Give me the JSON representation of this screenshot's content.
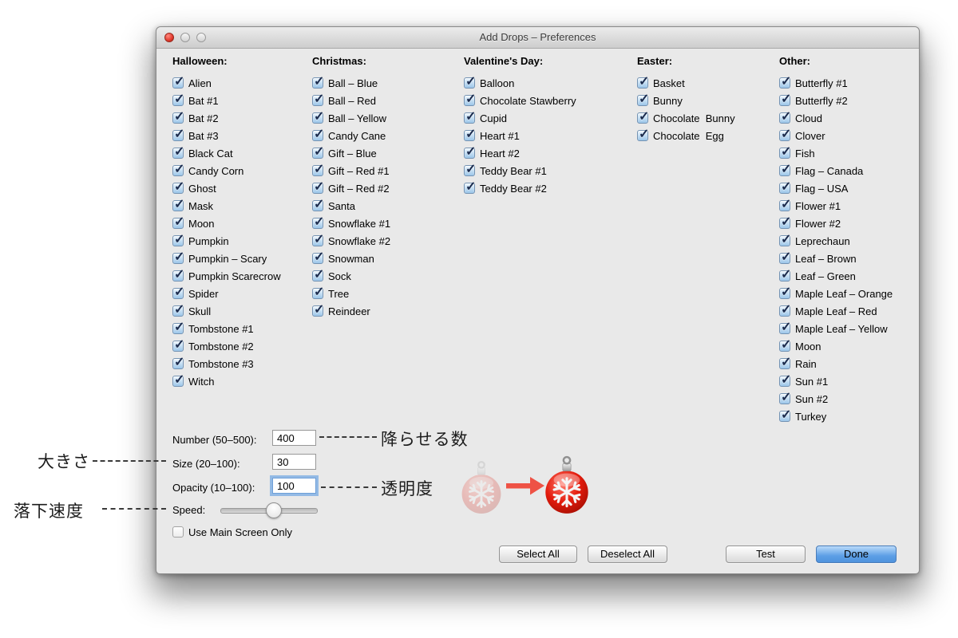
{
  "window": {
    "title": "Add Drops – Preferences"
  },
  "columns": [
    {
      "header": "Halloween:",
      "checked": true,
      "items": [
        "Alien",
        "Bat #1",
        "Bat #2",
        "Bat #3",
        "Black Cat",
        "Candy Corn",
        "Ghost",
        "Mask",
        "Moon",
        "Pumpkin",
        "Pumpkin – Scary",
        "Pumpkin Scarecrow",
        "Spider",
        "Skull",
        "Tombstone #1",
        "Tombstone #2",
        "Tombstone #3",
        "Witch"
      ]
    },
    {
      "header": "Christmas:",
      "checked": true,
      "items": [
        "Ball – Blue",
        "Ball – Red",
        "Ball – Yellow",
        "Candy Cane",
        "Gift – Blue",
        "Gift – Red #1",
        "Gift – Red #2",
        "Santa",
        "Snowflake #1",
        "Snowflake #2",
        "Snowman",
        "Sock",
        "Tree",
        "Reindeer"
      ]
    },
    {
      "header": "Valentine's Day:",
      "checked": true,
      "items": [
        "Balloon",
        "Chocolate Stawberry",
        "Cupid",
        "Heart #1",
        "Heart #2",
        "Teddy Bear #1",
        "Teddy Bear #2"
      ]
    },
    {
      "header": "Easter:",
      "checked": true,
      "items": [
        "Basket",
        "Bunny",
        "Chocolate  Bunny",
        "Chocolate  Egg"
      ]
    },
    {
      "header": "Other:",
      "checked": true,
      "items": [
        "Butterfly #1",
        "Butterfly #2",
        "Cloud",
        "Clover",
        "Fish",
        "Flag – Canada",
        "Flag – USA",
        "Flower #1",
        "Flower #2",
        "Leprechaun",
        "Leaf – Brown",
        "Leaf – Green",
        "Maple Leaf – Orange",
        "Maple Leaf – Red",
        "Maple Leaf – Yellow",
        "Moon",
        "Rain",
        "Sun #1",
        "Sun #2",
        "Turkey"
      ]
    }
  ],
  "form": {
    "number": {
      "label": "Number (50–500):",
      "value": "400"
    },
    "size": {
      "label": "Size (20–100):",
      "value": "30"
    },
    "opacity": {
      "label": "Opacity (10–100):",
      "value": "100",
      "focused": true
    },
    "speed": {
      "label": "Speed:",
      "slider_position_pct": 55
    },
    "use_main_screen": {
      "label": "Use Main Screen Only",
      "checked": false
    }
  },
  "buttons": {
    "select_all": "Select All",
    "deselect_all": "Deselect All",
    "test": "Test",
    "done": "Done"
  },
  "annotations": {
    "number_ja": "降らせる数",
    "size_ja": "大きさ",
    "opacity_ja": "透明度",
    "speed_ja": "落下速度"
  },
  "colors": {
    "window_bg": "#e9e9e9",
    "done_button_blue": "#5c9fe6",
    "focus_ring_blue": "#76aae3",
    "checkbox_blue": "#9cc6e9",
    "arrow_red": "#ee5245",
    "ornament_red": "#e31b0c",
    "close_button_red": "#e33a2e"
  }
}
